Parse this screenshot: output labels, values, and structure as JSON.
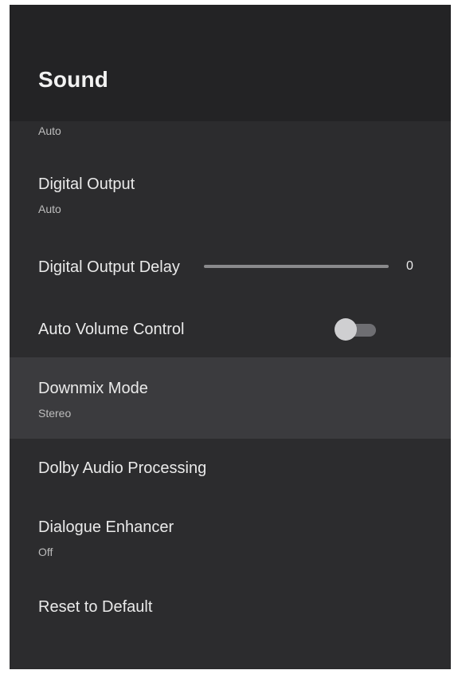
{
  "header": {
    "title": "Sound"
  },
  "settings": {
    "partial_item_value": "Auto",
    "digital_output": {
      "label": "Digital Output",
      "value": "Auto"
    },
    "digital_output_delay": {
      "label": "Digital Output Delay",
      "value": "0"
    },
    "auto_volume_control": {
      "label": "Auto Volume Control",
      "enabled": false
    },
    "downmix_mode": {
      "label": "Downmix Mode",
      "value": "Stereo"
    },
    "dolby_audio_processing": {
      "label": "Dolby Audio Processing"
    },
    "dialogue_enhancer": {
      "label": "Dialogue Enhancer",
      "value": "Off"
    },
    "reset_to_default": {
      "label": "Reset to Default"
    }
  },
  "colors": {
    "panel_background": "#2c2c2e",
    "header_background": "#232325",
    "focused_row": "#3b3b3e"
  }
}
